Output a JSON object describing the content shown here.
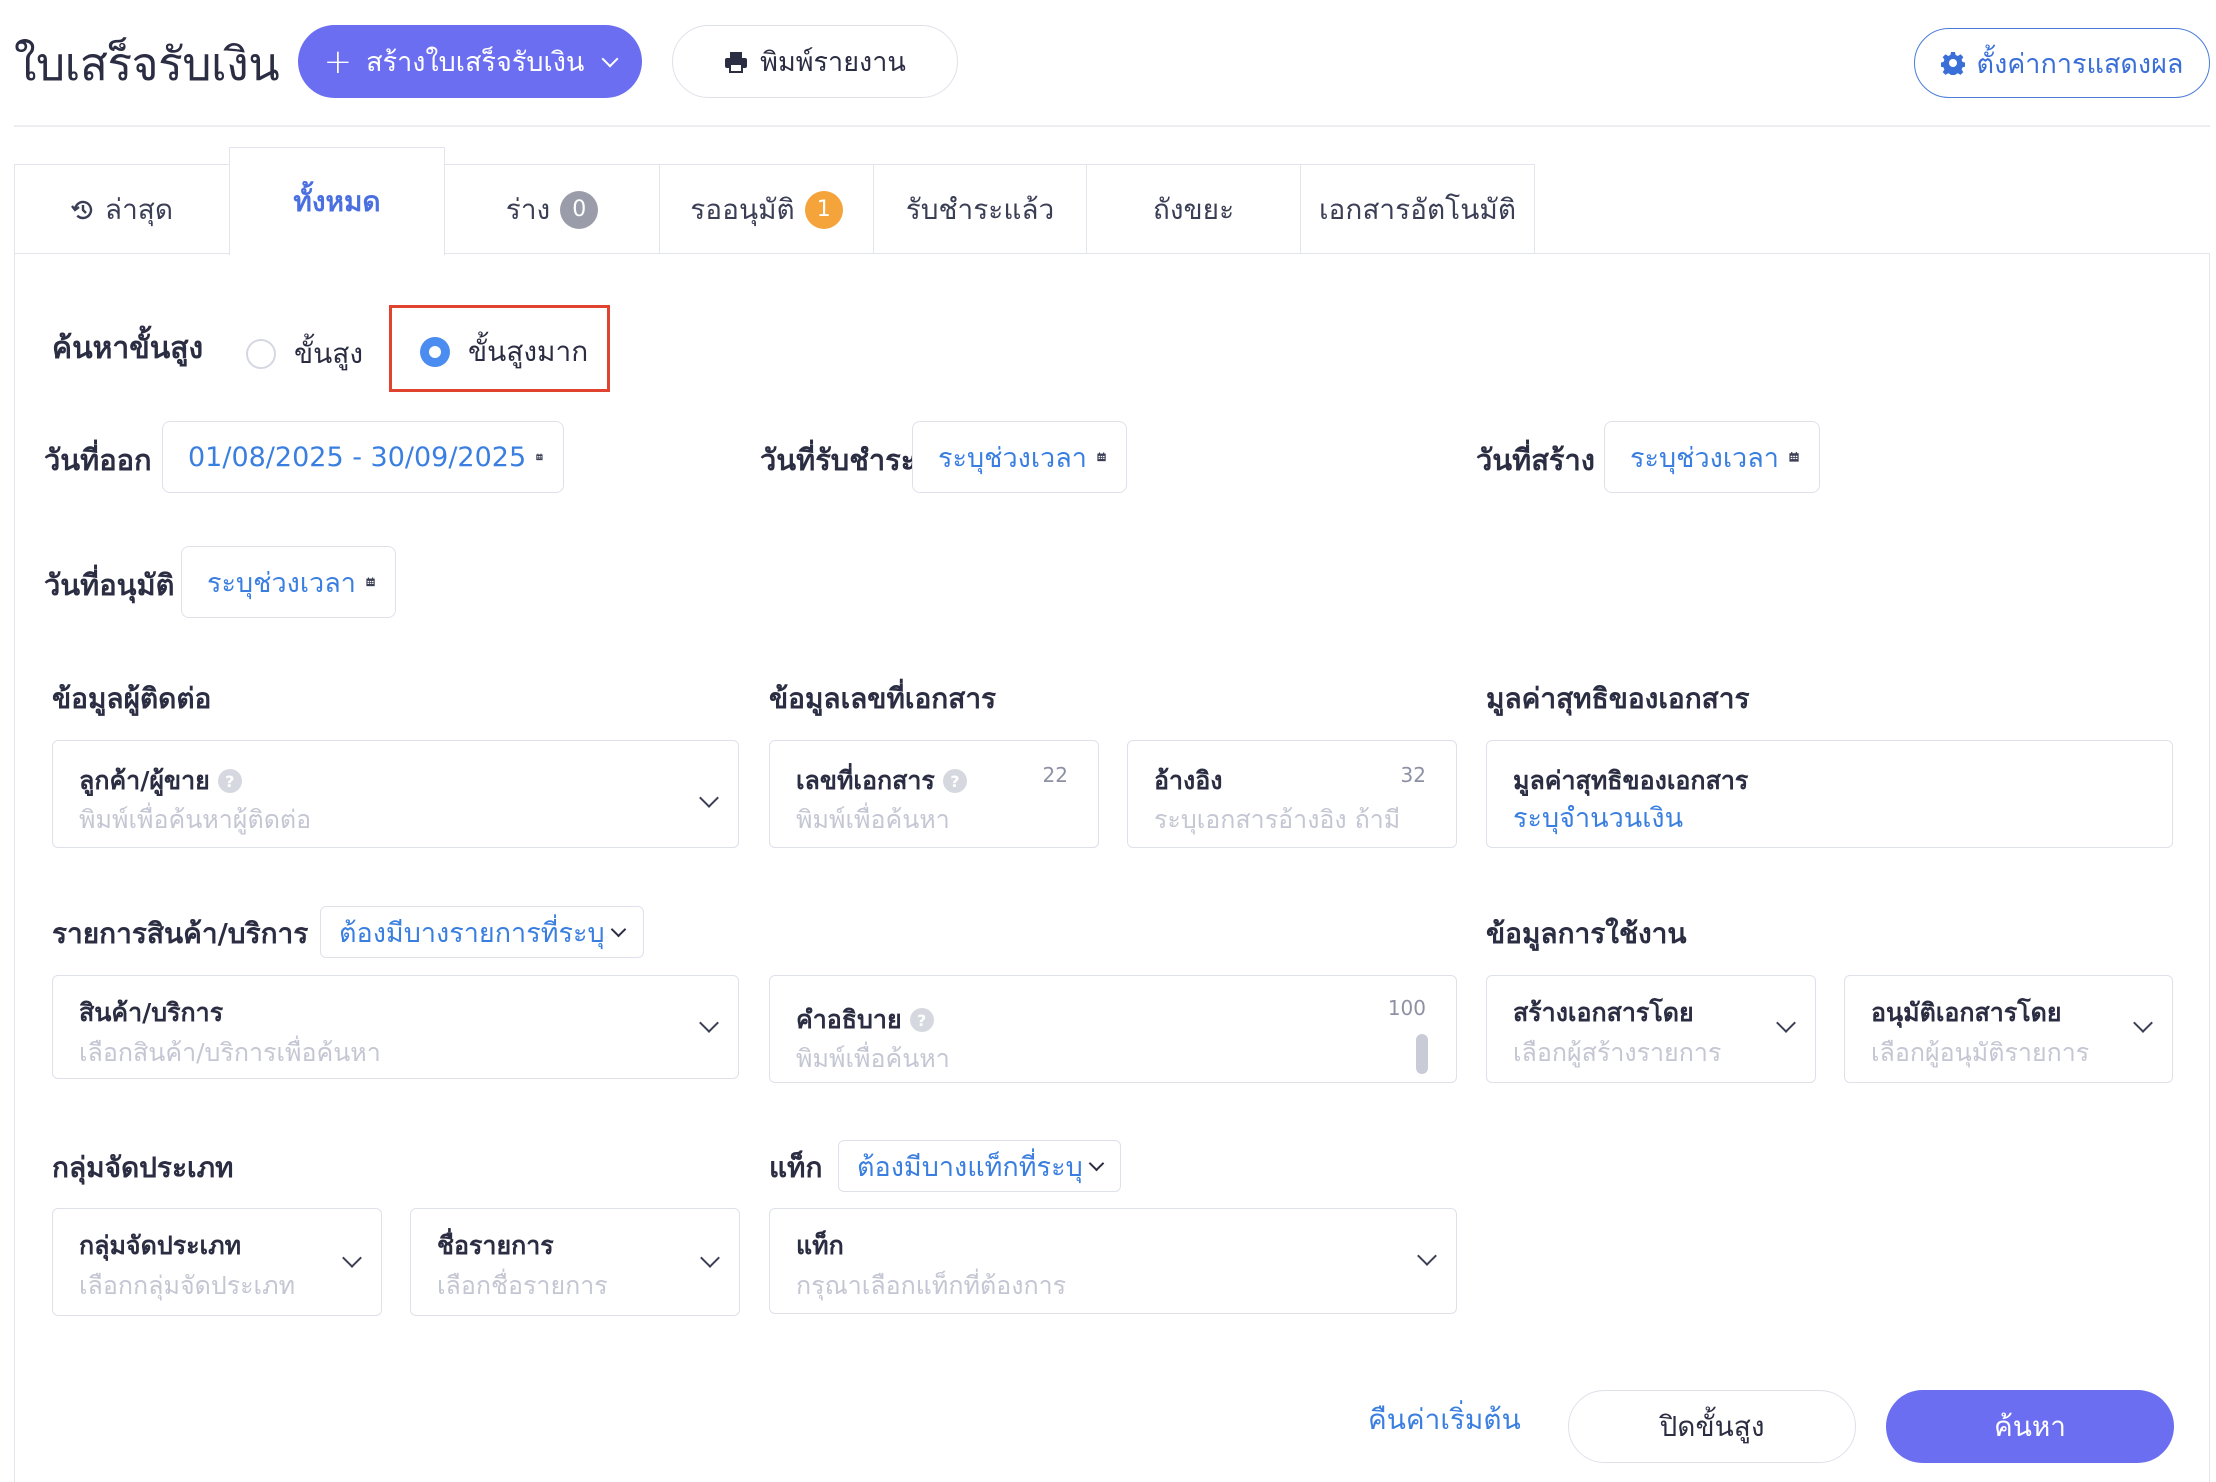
{
  "header": {
    "title": "ใบเสร็จรับเงิน",
    "create_button": "สร้างใบเสร็จรับเงิน",
    "print_button": "พิมพ์รายงาน",
    "settings_button": "ตั้งค่าการแสดงผล"
  },
  "tabs": [
    {
      "label": "ล่าสุด",
      "icon": "history-icon"
    },
    {
      "label": "ทั้งหมด",
      "active": true
    },
    {
      "label": "ร่าง",
      "badge": "0",
      "badge_color": "#9a9caa"
    },
    {
      "label": "รออนุมัติ",
      "badge": "1",
      "badge_color": "#f5a33b"
    },
    {
      "label": "รับชำระแล้ว"
    },
    {
      "label": "ถังขยะ"
    },
    {
      "label": "เอกสารอัตโนมัติ"
    }
  ],
  "search_mode": {
    "label": "ค้นหาขั้นสูง",
    "option_advanced": "ขั้นสูง",
    "option_extra_advanced": "ขั้นสูงมาก",
    "selected": "ขั้นสูงมาก"
  },
  "dates": {
    "issue": {
      "label": "วันที่ออก",
      "value": "01/08/2025 - 30/09/2025"
    },
    "payment": {
      "label": "วันที่รับชำระ",
      "value": "ระบุช่วงเวลา"
    },
    "created": {
      "label": "วันที่สร้าง",
      "value": "ระบุช่วงเวลา"
    },
    "approved": {
      "label": "วันที่อนุมัติ",
      "value": "ระบุช่วงเวลา"
    }
  },
  "contact_section": {
    "title": "ข้อมูลผู้ติดต่อ",
    "field_label": "ลูกค้า/ผู้ขาย",
    "placeholder": "พิมพ์เพื่อค้นหาผู้ติดต่อ"
  },
  "doc_number_section": {
    "title": "ข้อมูลเลขที่เอกสาร",
    "doc_no_label": "เลขที่เอกสาร",
    "doc_no_counter": "22",
    "doc_no_placeholder": "พิมพ์เพื่อค้นหา",
    "ref_label": "อ้างอิง",
    "ref_counter": "32",
    "ref_placeholder": "ระบุเอกสารอ้างอิง ถ้ามี"
  },
  "net_value_section": {
    "title": "มูลค่าสุทธิของเอกสาร",
    "field_label": "มูลค่าสุทธิของเอกสาร",
    "placeholder": "ระบุจำนวนเงิน"
  },
  "product_section": {
    "title": "รายการสินค้า/บริการ",
    "filter": "ต้องมีบางรายการที่ระบุ",
    "field_label": "สินค้า/บริการ",
    "placeholder": "เลือกสินค้า/บริการเพื่อค้นหา",
    "desc_label": "คำอธิบาย",
    "desc_counter": "100",
    "desc_placeholder": "พิมพ์เพื่อค้นหา"
  },
  "usage_section": {
    "title": "ข้อมูลการใช้งาน",
    "created_by_label": "สร้างเอกสารโดย",
    "created_by_placeholder": "เลือกผู้สร้างรายการ",
    "approved_by_label": "อนุมัติเอกสารโดย",
    "approved_by_placeholder": "เลือกผู้อนุมัติรายการ"
  },
  "category_section": {
    "title": "กลุ่มจัดประเภท",
    "group_label": "กลุ่มจัดประเภท",
    "group_placeholder": "เลือกกลุ่มจัดประเภท",
    "name_label": "ชื่อรายการ",
    "name_placeholder": "เลือกชื่อรายการ"
  },
  "tag_section": {
    "title": "แท็ก",
    "filter": "ต้องมีบางแท็กที่ระบุ",
    "field_label": "แท็ก",
    "placeholder": "กรุณาเลือกแท็กที่ต้องการ"
  },
  "actions": {
    "reset": "คืนค่าเริ่มต้น",
    "close": "ปิดขั้นสูง",
    "search": "ค้นหา"
  },
  "colors": {
    "primary": "#6b6ef0",
    "link": "#3a7fe0",
    "highlight": "#e0442e"
  }
}
